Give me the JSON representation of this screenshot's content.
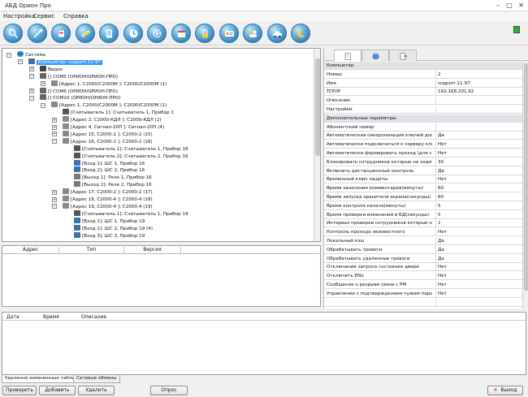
{
  "window": {
    "title": "АБД Орион Про",
    "min": "–",
    "max": "□",
    "close": "✕"
  },
  "menu": [
    "Настройка",
    "Сервис",
    "Справка"
  ],
  "toolbar_icons": [
    "search-icon",
    "tools-icon",
    "database-icon",
    "ruler-icon",
    "document-icon",
    "clock-icon",
    "settings-icon",
    "calendar-icon",
    "lock-icon",
    "id-card-icon",
    "users-icon",
    "car-icon",
    "moon-icon"
  ],
  "tree": [
    {
      "text": "Система",
      "indent": 0,
      "expand": "−",
      "icon": "globe"
    },
    {
      "text": "Компьютер: support-11-97",
      "indent": 1,
      "expand": "−",
      "icon": "computer",
      "selected": true
    },
    {
      "text": "Видео",
      "indent": 2,
      "expand": "+",
      "icon": "video"
    },
    {
      "text": "[] COM5 (ОРИОН/ОРИОН-ПРО)",
      "indent": 2,
      "expand": "−",
      "icon": "port"
    },
    {
      "text": "[Адрес 1, С2000/С2000М ]: С2000/С2000М (1)",
      "indent": 3,
      "expand": "+",
      "icon": "device"
    },
    {
      "text": "[] COM6 (ОРИОН/ОРИОН-ПРО)",
      "indent": 2,
      "expand": "+",
      "icon": "port"
    },
    {
      "text": "[] COM10 (ОРИОН/ОРИОН-ПРО)",
      "indent": 2,
      "expand": "−",
      "icon": "port"
    },
    {
      "text": "[Адрес 1, С2000/С2000М ]: С2000/С2000М (1)",
      "indent": 3,
      "expand": "−",
      "icon": "device"
    },
    {
      "text": "[Считыватель 1]: Считыватель 1, Прибор 1",
      "indent": 4,
      "expand": "",
      "icon": "reader"
    },
    {
      "text": "[Адрес 2, С2000-КДЛ ]: С2000-КДЛ (2)",
      "indent": 4,
      "expand": "+",
      "icon": "device"
    },
    {
      "text": "[Адрес 4, Сигнал-20П ]: Сигнал-20П (4)",
      "indent": 4,
      "expand": "+",
      "icon": "device"
    },
    {
      "text": "[Адрес 15, С2000-2 ]: С2000-2 (15)",
      "indent": 4,
      "expand": "+",
      "icon": "device"
    },
    {
      "text": "[Адрес 16, С2000-2 ]: С2000-2 (16)",
      "indent": 4,
      "expand": "−",
      "icon": "device"
    },
    {
      "text": "[Считыватель 1]: Считыватель 1, Прибор 16",
      "indent": 5,
      "expand": "",
      "icon": "reader"
    },
    {
      "text": "[Считыватель 2]: Считыватель 2, Прибор 16",
      "indent": 5,
      "expand": "",
      "icon": "reader"
    },
    {
      "text": "[Вход 1]: ШС 1, Прибор 16",
      "indent": 5,
      "expand": "",
      "icon": "input"
    },
    {
      "text": "[Вход 2]: ШС 2, Прибор 16",
      "indent": 5,
      "expand": "",
      "icon": "input"
    },
    {
      "text": "[Выход 1]: Реле 1, Прибор 16",
      "indent": 5,
      "expand": "",
      "icon": "relay"
    },
    {
      "text": "[Выход 2]: Реле 2, Прибор 16",
      "indent": 5,
      "expand": "",
      "icon": "relay"
    },
    {
      "text": "[Адрес 17, С2000-2 ]: С2000-2 (17)",
      "indent": 4,
      "expand": "+",
      "icon": "device"
    },
    {
      "text": "[Адрес 18, С2000-4 ]: С2000-4 (18)",
      "indent": 4,
      "expand": "+",
      "icon": "device"
    },
    {
      "text": "[Адрес 19, С2000-4 ]: С2000-4 (19)",
      "indent": 4,
      "expand": "−",
      "icon": "device"
    },
    {
      "text": "[Считыватель 1]: Считыватель 1, Прибор 19",
      "indent": 5,
      "expand": "",
      "icon": "reader"
    },
    {
      "text": "[Вход 1]: ШС 1, Прибор 19",
      "indent": 5,
      "expand": "",
      "icon": "input"
    },
    {
      "text": "[Вход 2]: ШС 2, Прибор 19 (4)",
      "indent": 5,
      "expand": "",
      "icon": "input"
    },
    {
      "text": "[Вход 3]: ШС 3, Прибор 19",
      "indent": 5,
      "expand": "",
      "icon": "input"
    }
  ],
  "device_table": {
    "columns": [
      "Адрес",
      "Тип",
      "Версия"
    ]
  },
  "properties": [
    {
      "name": "Компьютер",
      "value": "",
      "category": true
    },
    {
      "name": "Номер",
      "value": "2"
    },
    {
      "name": "Имя",
      "value": "support-11-97"
    },
    {
      "name": "TCP/IP",
      "value": "192.168.201.62"
    },
    {
      "name": "Описание",
      "value": ""
    },
    {
      "name": "Настройки",
      "value": ""
    },
    {
      "name": "Дополнительные параметры",
      "value": "",
      "category": true
    },
    {
      "name": "Абонентский номер",
      "value": ""
    },
    {
      "name": "Автоматическая синхронизация ключей доступа",
      "value": "Да"
    },
    {
      "name": "Автоматически подключаться к серверу ключниц",
      "value": "Нет"
    },
    {
      "name": "Автоматически формировать проход (для старых",
      "value": "Нет"
    },
    {
      "name": "Блокировать сотрудников которые не ходят на",
      "value": "30"
    },
    {
      "name": "Включить дистанционный контроль",
      "value": "Да"
    },
    {
      "name": "Временный ключ защиты",
      "value": "Нет"
    },
    {
      "name": "Время занесения комментария(минуты)",
      "value": "60"
    },
    {
      "name": "Время запуска хранителя экрана(секунды)",
      "value": "60"
    },
    {
      "name": "Время контроля канала(минуты)",
      "value": "5"
    },
    {
      "name": "Время проверки изменений в БД(секунды)",
      "value": "5"
    },
    {
      "name": "Интервал проверки сотрудников которые не хо",
      "value": "1"
    },
    {
      "name": "Контроль прохода неизвестного",
      "value": "Нет"
    },
    {
      "name": "Локальный кэш",
      "value": "Да"
    },
    {
      "name": "Обрабатывать тревоги",
      "value": "Да"
    },
    {
      "name": "Обрабатывать удаленные тревоги",
      "value": "Да"
    },
    {
      "name": "Отключение запроса состояния двери",
      "value": "Нет"
    },
    {
      "name": "Отключить ENo",
      "value": "Нет"
    },
    {
      "name": "Сообщение о разрыве связи с РМ",
      "value": "Нет"
    },
    {
      "name": "Управление с подтверждением чужим паролем",
      "value": "Нет"
    },
    {
      "name": "",
      "value": ""
    }
  ],
  "events": {
    "columns": [
      "Дата",
      "Время",
      "Описание"
    ]
  },
  "bottom_tabs": [
    "Удаленно измененные таблицы",
    "Сетевые обмены"
  ],
  "buttons": [
    "Проверить",
    "Добавить",
    "Удалить",
    "Опрос"
  ],
  "exit_button": "Выход"
}
